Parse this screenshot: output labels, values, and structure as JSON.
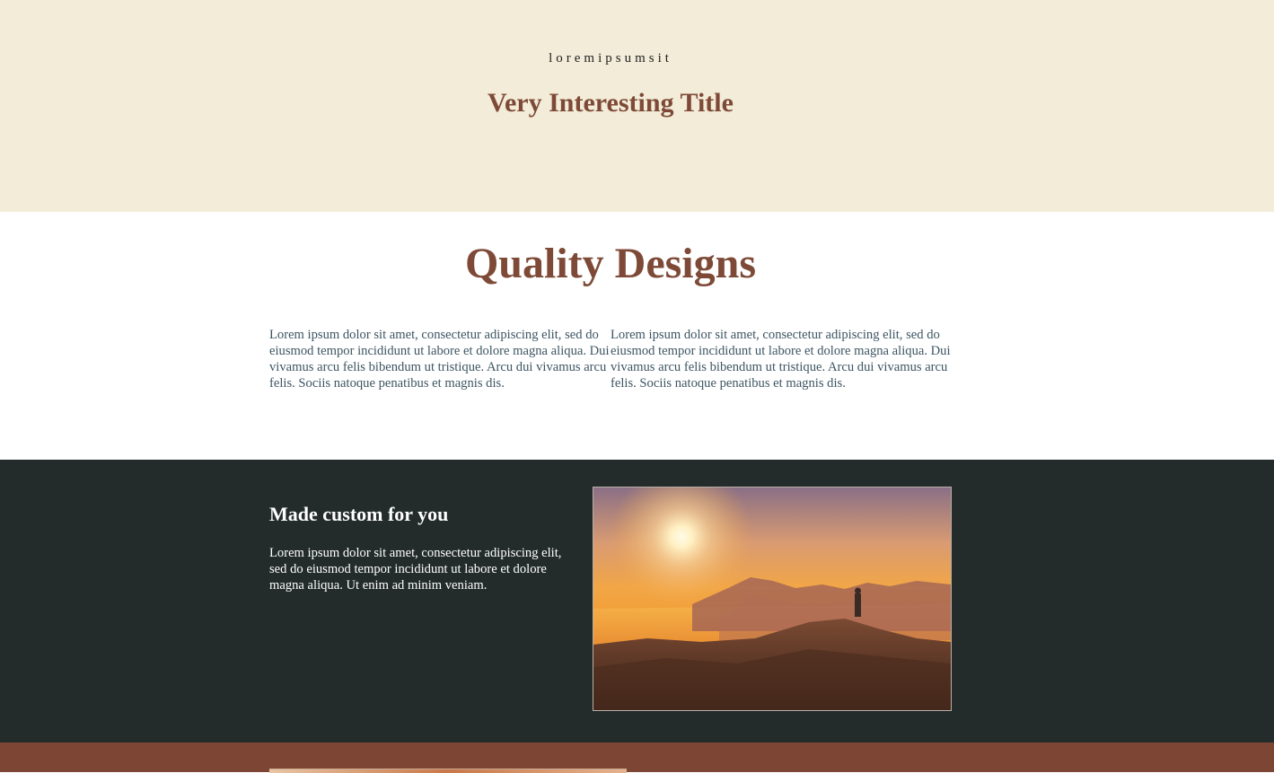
{
  "hero": {
    "tagline": "loremipsumsit",
    "title": "Very Interesting Title"
  },
  "quality": {
    "heading": "Quality Designs",
    "columns": [
      "Lorem ipsum dolor sit amet, consectetur adipiscing elit, sed do eiusmod tempor incididunt ut labore et dolore magna aliqua. Dui vivamus arcu felis bibendum ut tristique. Arcu dui vivamus arcu felis. Sociis natoque penatibus et magnis dis.",
      "Lorem ipsum dolor sit amet, consectetur adipiscing elit, sed do eiusmod tempor incididunt ut labore et dolore magna aliqua. Dui vivamus arcu felis bibendum ut tristique. Arcu dui vivamus arcu felis. Sociis natoque penatibus et magnis dis."
    ]
  },
  "custom": {
    "heading": "Made custom for you",
    "body": "Lorem ipsum dolor sit amet, consectetur adipiscing elit, sed do eiusmod tempor incididunt ut labore et dolore magna aliqua. Ut enim ad minim veniam."
  },
  "colors": {
    "hero_bg": "#f2ecd9",
    "accent_brown": "#7e4a37",
    "dark_band": "#232b2b",
    "footer_band": "#7d4533",
    "body_text": "#3d5562"
  }
}
